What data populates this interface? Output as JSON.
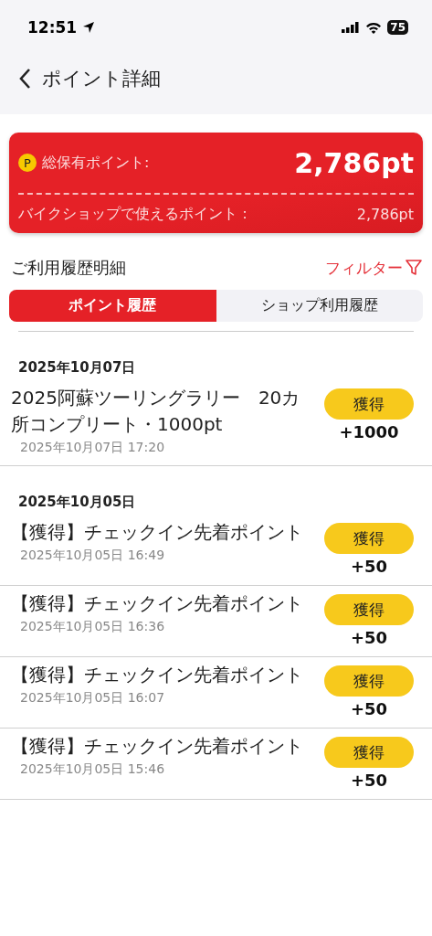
{
  "status_bar": {
    "time": "12:51",
    "battery": "75"
  },
  "header": {
    "title": "ポイント詳細"
  },
  "summary": {
    "total_label": "総保有ポイント:",
    "total_value": "2,786pt",
    "shop_label": "バイクショップで使えるポイント：",
    "shop_value": "2,786pt",
    "coin": "P"
  },
  "section": {
    "title": "ご利用履歴明細",
    "filter": "フィルター"
  },
  "tabs": [
    {
      "label": "ポイント履歴",
      "selected": true
    },
    {
      "label": "ショップ利用履歴",
      "selected": false
    }
  ],
  "groups": [
    {
      "date": "2025年10月07日",
      "entries": [
        {
          "title": "2025阿蘇ツーリングラリー　20カ所コンプリート・1000pt",
          "time": "2025年10月07日 17:20",
          "badge": "獲得",
          "amount": "+1000"
        }
      ]
    },
    {
      "date": "2025年10月05日",
      "entries": [
        {
          "title": "【獲得】チェックイン先着ポイント",
          "time": "2025年10月05日 16:49",
          "badge": "獲得",
          "amount": "+50"
        },
        {
          "title": "【獲得】チェックイン先着ポイント",
          "time": "2025年10月05日 16:36",
          "badge": "獲得",
          "amount": "+50"
        },
        {
          "title": "【獲得】チェックイン先着ポイント",
          "time": "2025年10月05日 16:07",
          "badge": "獲得",
          "amount": "+50"
        },
        {
          "title": "【獲得】チェックイン先着ポイント",
          "time": "2025年10月05日 15:46",
          "badge": "獲得",
          "amount": "+50"
        }
      ]
    }
  ]
}
